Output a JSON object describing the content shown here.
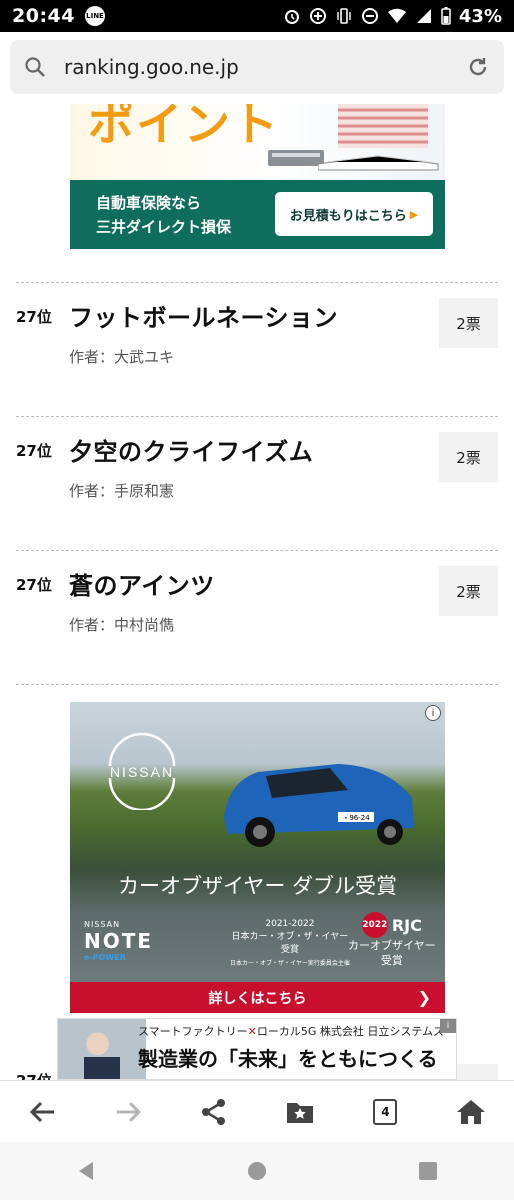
{
  "status_bar": {
    "time": "20:44",
    "notification_app": "LINE",
    "battery": "43%",
    "icons": [
      "alarm-icon",
      "data-saver-icon",
      "vibrate-icon",
      "dnd-icon",
      "wifi-icon",
      "signal-icon",
      "battery-icon"
    ]
  },
  "browser": {
    "url": "ranking.goo.ne.jp",
    "tab_count": "4"
  },
  "ad_top": {
    "headline_fragment": "ポイント",
    "line1": "自動車保険なら",
    "line2": "三井ダイレクト損保",
    "cta": "お見積もりはこちら"
  },
  "ranking": [
    {
      "rank": "27位",
      "title": "フットボールネーション",
      "author": "作者：大武ユキ",
      "votes": "2票"
    },
    {
      "rank": "27位",
      "title": "夕空のクライフイズム",
      "author": "作者：手原和憲",
      "votes": "2票"
    },
    {
      "rank": "27位",
      "title": "蒼のアインツ",
      "author": "作者：中村尚儁",
      "votes": "2票"
    }
  ],
  "partial_next_rank": "27位",
  "ad_nissan": {
    "brand": "NISSAN",
    "headline": "カーオブザイヤー ダブル受賞",
    "model_small": "NISSAN",
    "model": "NOTE",
    "powertrain": "e-POWER",
    "award_year": "2021-2022",
    "award_name1": "日本カー・オブ・ザ・イヤー",
    "award_name2": "受賞",
    "award_org": "日本カー・オブ・ザ・イヤー実行委員会主催",
    "rjc_year": "2022",
    "rjc_mark": "RJC",
    "rjc_line1": "カーオブザイヤー",
    "rjc_line2": "受賞",
    "cta": "詳しくはこちら",
    "plate": "・96-24"
  },
  "ad_banner": {
    "line1_a": "スマートファクトリー",
    "line1_x": "✕",
    "line1_b": "ローカル5G",
    "line1_c": "株式会社 日立システムズ",
    "line2": "製造業の「未来」をともにつくる",
    "info": "i"
  },
  "colors": {
    "ad_green": "#0f6d5e",
    "nissan_red": "#c8102e",
    "accent_orange": "#f39c12"
  }
}
